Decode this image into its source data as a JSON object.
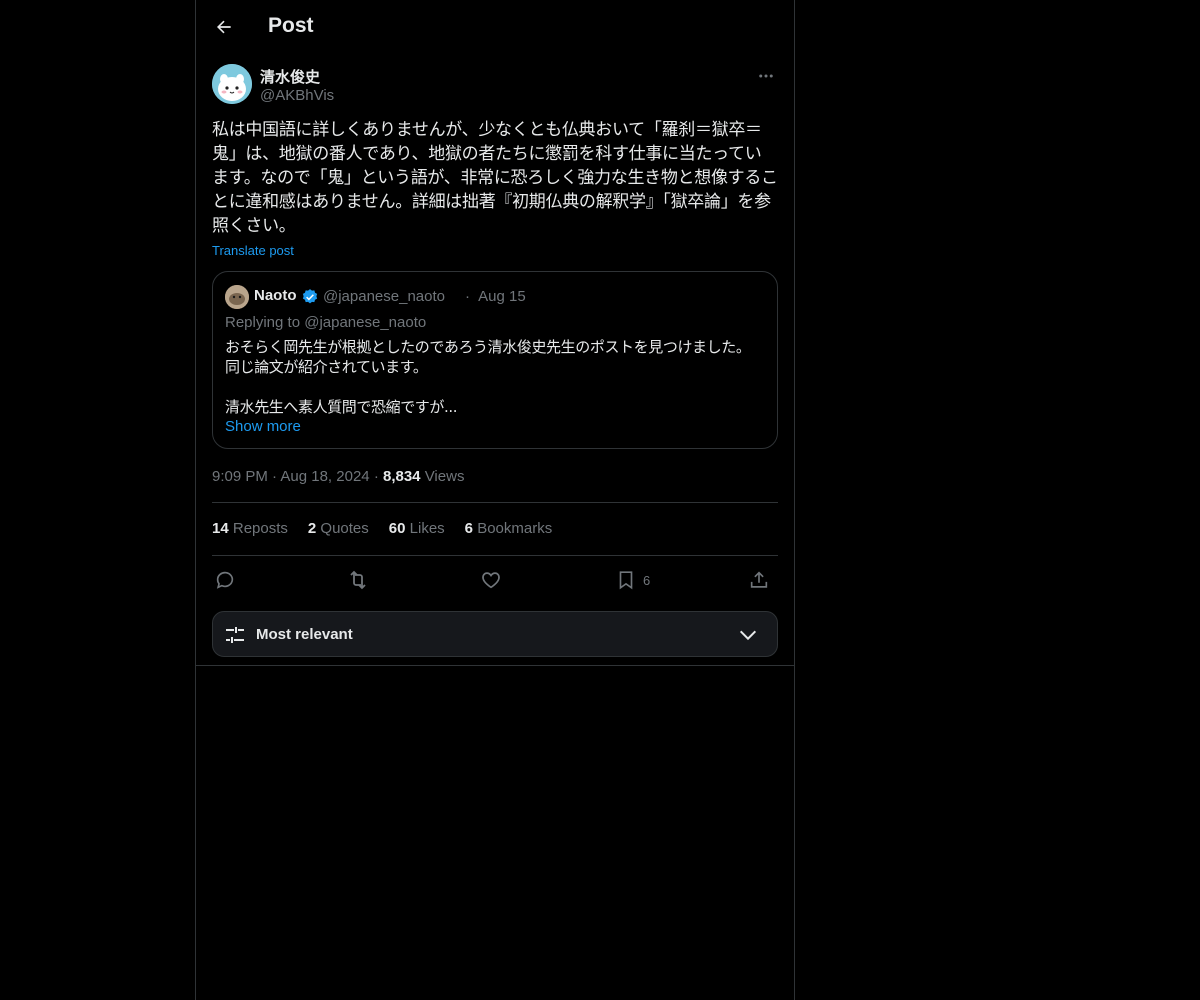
{
  "header": {
    "title": "Post"
  },
  "post": {
    "author_name": "清水俊史",
    "author_handle": "@AKBhVis",
    "text": "私は中国語に詳しくありませんが、少なくとも仏典おいて「羅刹＝獄卒＝鬼」は、地獄の番人であり、地獄の者たちに懲罰を科す仕事に当たっています。なので「鬼」という語が、非常に恐ろしく強力な生き物と想像することに違和感はありません。詳細は拙著『初期仏典の解釈学』「獄卒論」を参照くさい。",
    "translate_label": "Translate post",
    "time": "9:09 PM",
    "date": "Aug 18, 2024",
    "views_count": "8,834",
    "views_label": "Views"
  },
  "quote": {
    "author_name": "Naoto",
    "author_handle": "@japanese_naoto",
    "separator": "·",
    "date": "Aug 15",
    "replying_to": "Replying to @japanese_naoto",
    "line1": "おそらく岡先生が根拠としたのであろう清水俊史先生のポストを見つけました。",
    "line2": "同じ論文が紹介されています。",
    "line3": "清水先生へ素人質問で恐縮ですが...",
    "show_more": "Show more"
  },
  "stats": [
    {
      "count": "14",
      "label": "Reposts"
    },
    {
      "count": "2",
      "label": "Quotes"
    },
    {
      "count": "60",
      "label": "Likes"
    },
    {
      "count": "6",
      "label": "Bookmarks"
    }
  ],
  "actions": {
    "bookmark_count": "6",
    "icons": [
      "reply-icon",
      "repost-icon",
      "like-icon",
      "bookmark-icon",
      "share-icon"
    ]
  },
  "sort": {
    "label": "Most relevant"
  },
  "colors": {
    "background": "#000000",
    "text": "#e7e9ea",
    "secondary": "#71767b",
    "link": "#1d9bf0",
    "border": "#2f3336"
  }
}
